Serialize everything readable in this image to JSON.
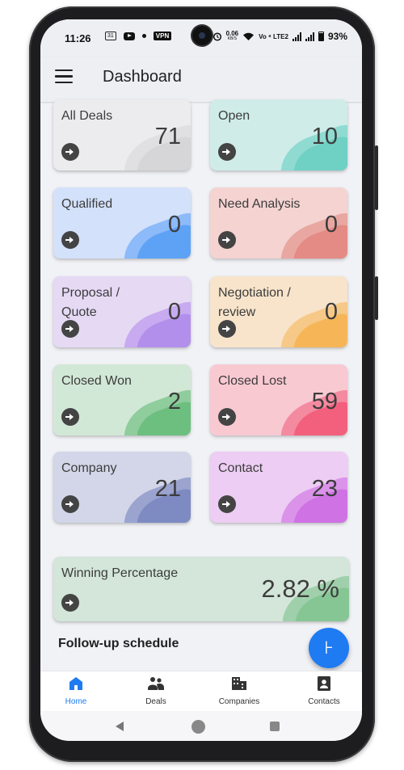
{
  "status_bar": {
    "time": "11:26",
    "calendar_badge": "31",
    "vpn": "VPN",
    "speed_value": "0.06",
    "speed_unit": "KB/S",
    "network": "Vo ⁸ LTE2",
    "battery": "93%"
  },
  "appbar": {
    "title": "Dashboard"
  },
  "cards": [
    {
      "label": "All Deals",
      "value": "71",
      "bg": "#ececee",
      "blob1": "#e0e0e2",
      "blob2": "#d6d6d8"
    },
    {
      "label": "Open",
      "value": "10",
      "bg": "#cfece9",
      "blob1": "#8fdbd1",
      "blob2": "#6fd0c4"
    },
    {
      "label": "Qualified",
      "value": "0",
      "bg": "#d3e1fb",
      "blob1": "#8dbaf8",
      "blob2": "#5ea2f6"
    },
    {
      "label": "Need Analysis",
      "value": "0",
      "bg": "#f4d3d1",
      "blob1": "#e9a7a2",
      "blob2": "#e48b85"
    },
    {
      "label": "Proposal / Quote",
      "value": "0",
      "bg": "#e5d9f4",
      "blob1": "#c8aaf0",
      "blob2": "#b38fec"
    },
    {
      "label": "Negotiation / review",
      "value": "0",
      "bg": "#f8e4cb",
      "blob1": "#f6c988",
      "blob2": "#f6b658"
    },
    {
      "label": "Closed Won",
      "value": "2",
      "bg": "#d2e8d7",
      "blob1": "#8fcd9c",
      "blob2": "#6dbf80"
    },
    {
      "label": "Closed Lost",
      "value": "59",
      "bg": "#f9c9d2",
      "blob1": "#f48aa0",
      "blob2": "#f2607d"
    },
    {
      "label": "Company",
      "value": "21",
      "bg": "#d2d6e8",
      "blob1": "#9aa4cf",
      "blob2": "#7e8bc3"
    },
    {
      "label": "Contact",
      "value": "23",
      "bg": "#edcdf3",
      "blob1": "#db93ea",
      "blob2": "#cf72e4"
    }
  ],
  "winning": {
    "label": "Winning Percentage",
    "value": "2.82 %",
    "bg": "#d3e6d9",
    "blob1": "#9fd0ab",
    "blob2": "#86c594"
  },
  "followup": {
    "title": "Follow-up schedule"
  },
  "fab": {
    "glyph": "⊦"
  },
  "bottom_nav": [
    {
      "label": "Home",
      "icon": "home-icon",
      "active": true
    },
    {
      "label": "Deals",
      "icon": "people-icon",
      "active": false
    },
    {
      "label": "Companies",
      "icon": "building-icon",
      "active": false
    },
    {
      "label": "Contacts",
      "icon": "contact-card-icon",
      "active": false
    }
  ],
  "accent": "#1e7bf2"
}
